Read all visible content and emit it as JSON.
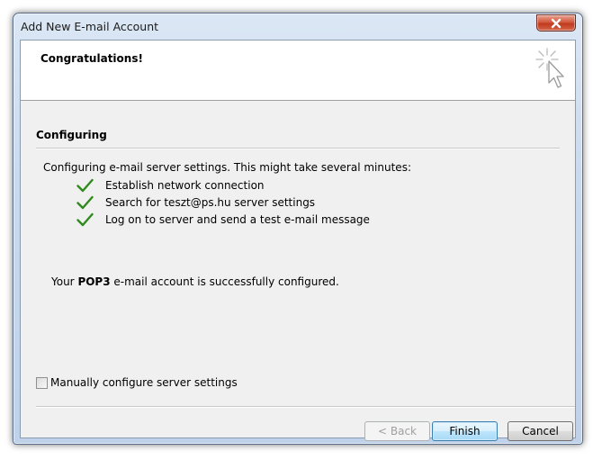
{
  "window": {
    "title": "Add New E-mail Account",
    "close_label": "Close"
  },
  "header": {
    "title": "Congratulations!"
  },
  "section": {
    "heading": "Configuring",
    "intro": "Configuring e-mail server settings. This might take several minutes:",
    "steps": [
      {
        "label": "Establish network connection",
        "status": "done",
        "icon": "check-icon"
      },
      {
        "label": "Search for teszt@ps.hu server settings",
        "status": "done",
        "icon": "check-icon"
      },
      {
        "label": "Log on to server and send a test e-mail message",
        "status": "done",
        "icon": "check-icon"
      }
    ],
    "result_prefix": "Your ",
    "result_protocol": "POP3",
    "result_suffix": " e-mail account is successfully configured."
  },
  "options": {
    "manual_configure_label": "Manually configure server settings",
    "manual_configure_checked": false
  },
  "buttons": {
    "back": "< Back",
    "finish": "Finish",
    "cancel": "Cancel"
  },
  "colors": {
    "check": "#2f8a1e",
    "title_bar": "#c9d9ee",
    "close_button": "#c8452a"
  }
}
